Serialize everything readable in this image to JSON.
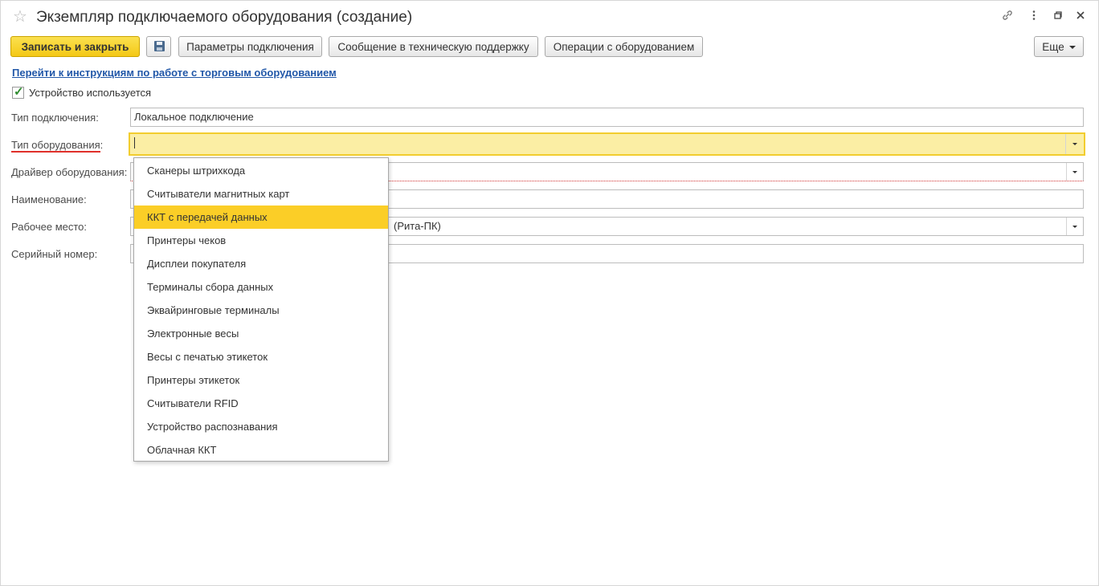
{
  "window": {
    "title": "Экземпляр подключаемого оборудования (создание)",
    "icons": [
      "star-icon",
      "link-icon",
      "more-vertical-icon",
      "restore-icon",
      "close-icon"
    ]
  },
  "toolbar": {
    "save_close_label": "Записать и закрыть",
    "save_icon": "floppy-disk-icon",
    "connection_params_label": "Параметры подключения",
    "support_message_label": "Сообщение в техническую поддержку",
    "equipment_ops_label": "Операции с оборудованием",
    "more_label": "Еще"
  },
  "help_link": "Перейти к инструкциям по работе с торговым оборудованием",
  "device_used": {
    "label": "Устройство используется",
    "checked": true
  },
  "fields": {
    "connection_type": {
      "label": "Тип подключения:",
      "value": "Локальное подключение"
    },
    "equipment_type": {
      "label": "Тип оборудования:",
      "value": ""
    },
    "driver": {
      "label": "Драйвер оборудования:",
      "value": ""
    },
    "name": {
      "label": "Наименование:",
      "value": ""
    },
    "workplace": {
      "label": "Рабочее место:",
      "value": "(Рита-ПК)"
    },
    "serial": {
      "label": "Серийный номер:",
      "value": ""
    }
  },
  "dropdown": {
    "items": [
      "Сканеры штрихкода",
      "Считыватели магнитных карт",
      "ККТ с передачей данных",
      "Принтеры чеков",
      "Дисплеи покупателя",
      "Терминалы сбора данных",
      "Эквайринговые терминалы",
      "Электронные весы",
      "Весы с печатью этикеток",
      "Принтеры этикеток",
      "Считыватели RFID",
      "Устройство распознавания",
      "Облачная ККТ"
    ],
    "selected_index": 2
  },
  "colors": {
    "primary_button": "#f4c816",
    "active_field": "#fbeea4",
    "selected_item": "#fbce27",
    "link": "#2157a8",
    "required_underline": "#e0302a"
  }
}
